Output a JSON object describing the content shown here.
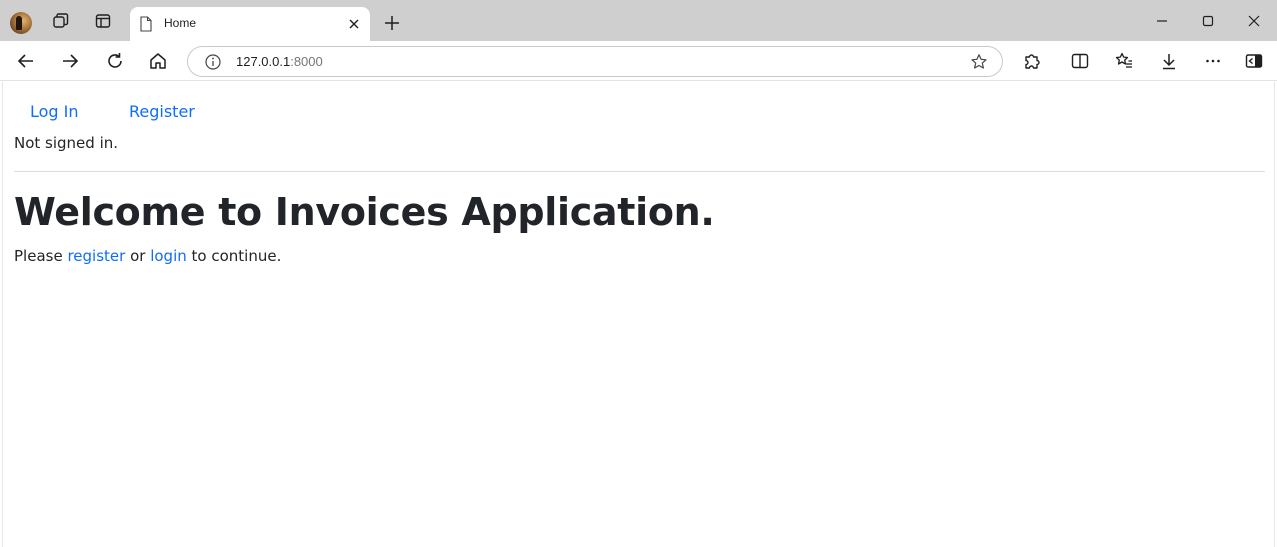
{
  "browser": {
    "tab": {
      "title": "Home"
    },
    "address_bar": {
      "host": "127.0.0.1",
      "port": ":8000"
    },
    "icons": {
      "profile": "profile-avatar",
      "workspaces": "workspaces-icon",
      "tab_actions": "tab-actions-icon",
      "page": "page-icon",
      "close_tab": "close-icon",
      "new_tab": "plus-icon",
      "back": "arrow-left-icon",
      "forward": "arrow-right-icon",
      "reload": "reload-icon",
      "home": "home-icon",
      "site_info": "info-icon",
      "favorite": "star-icon",
      "extensions": "puzzle-icon",
      "split_screen": "split-screen-icon",
      "favorites": "favorites-list-icon",
      "downloads": "download-icon",
      "more": "more-icon",
      "sidebar": "sidebar-icon"
    }
  },
  "page": {
    "nav": {
      "login_label": "Log In",
      "register_label": "Register"
    },
    "status": "Not signed in.",
    "heading": "Welcome to Invoices Application.",
    "lead": {
      "prefix": "Please ",
      "register_link": "register",
      "middle": " or ",
      "login_link": "login",
      "suffix": " to continue."
    }
  },
  "colors": {
    "link": "#0d6efd",
    "text": "#212529",
    "titlebar": "#cfcfcf"
  }
}
